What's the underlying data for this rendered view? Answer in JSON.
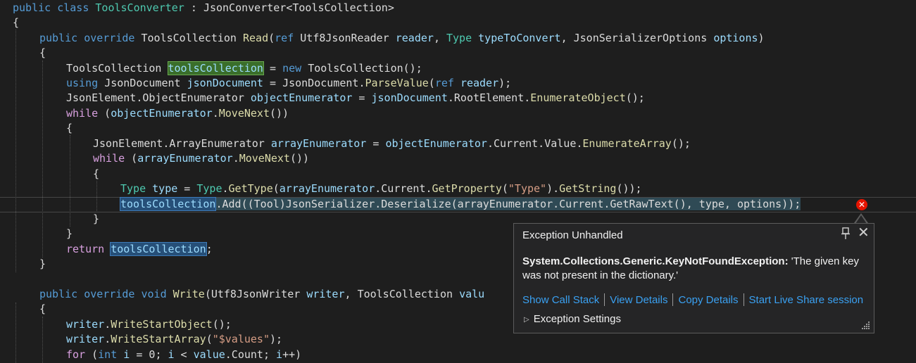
{
  "code": {
    "l1": {
      "a": "public",
      "b": "class",
      "c": "ToolsConverter",
      "d": " : ",
      "e": "JsonConverter",
      "f": "<",
      "g": "ToolsCollection",
      "h": ">"
    },
    "l2": {
      "a": "{"
    },
    "l3": {
      "a": "public",
      "b": "override",
      "c": "ToolsCollection",
      "d": "Read",
      "e": "(",
      "f": "ref",
      "g": "Utf8JsonReader",
      "h": "reader",
      "i": ", ",
      "j": "Type",
      "k": "typeToConvert",
      "l": ", ",
      "m": "JsonSerializerOptions",
      "n": "options",
      "o": ")"
    },
    "l4": {
      "a": "{"
    },
    "l5": {
      "a": "ToolsCollection",
      "b": "toolsCollection",
      "c": " = ",
      "d": "new",
      "e": "ToolsCollection",
      "f": "();"
    },
    "l6": {
      "a": "using",
      "b": "JsonDocument",
      "c": "jsonDocument",
      "d": " = ",
      "e": "JsonDocument",
      "f": ".",
      "g": "ParseValue",
      "h": "(",
      "i": "ref",
      "j": "reader",
      "k": ");"
    },
    "l7": {
      "a": "JsonElement",
      "b": ".",
      "c": "ObjectEnumerator",
      "d": "objectEnumerator",
      "e": " = ",
      "f": "jsonDocument",
      "g": ".RootElement.",
      "h": "EnumerateObject",
      "i": "();"
    },
    "l8": {
      "a": "while",
      "b": " (",
      "c": "objectEnumerator",
      "d": ".",
      "e": "MoveNext",
      "f": "())"
    },
    "l9": {
      "a": "{"
    },
    "l10": {
      "a": "JsonElement",
      "b": ".",
      "c": "ArrayEnumerator",
      "d": "arrayEnumerator",
      "e": " = ",
      "f": "objectEnumerator",
      "g": ".Current.Value.",
      "h": "EnumerateArray",
      "i": "();"
    },
    "l11": {
      "a": "while",
      "b": " (",
      "c": "arrayEnumerator",
      "d": ".",
      "e": "MoveNext",
      "f": "())"
    },
    "l12": {
      "a": "{"
    },
    "l13": {
      "a": "Type",
      "b": "type",
      "c": " = ",
      "d": "Type",
      "e": ".",
      "f": "GetType",
      "g": "(",
      "h": "arrayEnumerator",
      "i": ".Current.",
      "j": "GetProperty",
      "k": "(",
      "l": "\"Type\"",
      "m": ").",
      "n": "GetString",
      "o": "());"
    },
    "l14": {
      "a": "toolsCollection",
      "b": ".Add((Tool)JsonSerializer.Deserialize(arrayEnumerator.Current.GetRawText(), type, options));"
    },
    "l15": {
      "a": "}"
    },
    "l16": {
      "a": "}"
    },
    "l17": {
      "a": "return",
      "b": "toolsCollection",
      "c": ";"
    },
    "l18": {
      "a": "}"
    },
    "l19": {
      "a": "public",
      "b": "override",
      "c": "void",
      "d": "Write",
      "e": "(",
      "f": "Utf8JsonWriter",
      "g": "writer",
      "h": ", ",
      "i": "ToolsCollection",
      "j": "valu"
    },
    "l20": {
      "a": "{"
    },
    "l21": {
      "a": "writer",
      "b": ".",
      "c": "WriteStartObject",
      "d": "();"
    },
    "l22": {
      "a": "writer",
      "b": ".",
      "c": "WriteStartArray",
      "d": "(",
      "e": "\"$values\"",
      "f": ");"
    },
    "l23": {
      "a": "for",
      "b": " (",
      "c": "int",
      "d": "i",
      "e": " = ",
      "f": "0",
      "g": "; ",
      "h": "i",
      "i": " < ",
      "j": "value",
      "k": ".Count; ",
      "l": "i",
      "m": "++)"
    }
  },
  "error_glyph": {
    "symbol": "✕",
    "icon": "error-icon"
  },
  "popup": {
    "title": "Exception Unhandled",
    "pin_symbol": "📌",
    "close_symbol": "✕",
    "exception_type": "System.Collections.Generic.KeyNotFoundException:",
    "exception_message": " 'The given key was not present in the dictionary.'",
    "links": {
      "call_stack": "Show Call Stack",
      "view_details": "View Details",
      "copy_details": "Copy Details",
      "live_share": "Start Live Share session"
    },
    "settings_label": "Exception Settings",
    "settings_arrow": "▷"
  },
  "colors": {
    "background": "#1e1e1e",
    "keyword": "#569cd6",
    "type": "#4ec9b0",
    "identifier": "#9cdcfe",
    "method": "#dcdcaa",
    "string": "#d69d85",
    "error": "#e51400",
    "link": "#3aa1f2"
  }
}
